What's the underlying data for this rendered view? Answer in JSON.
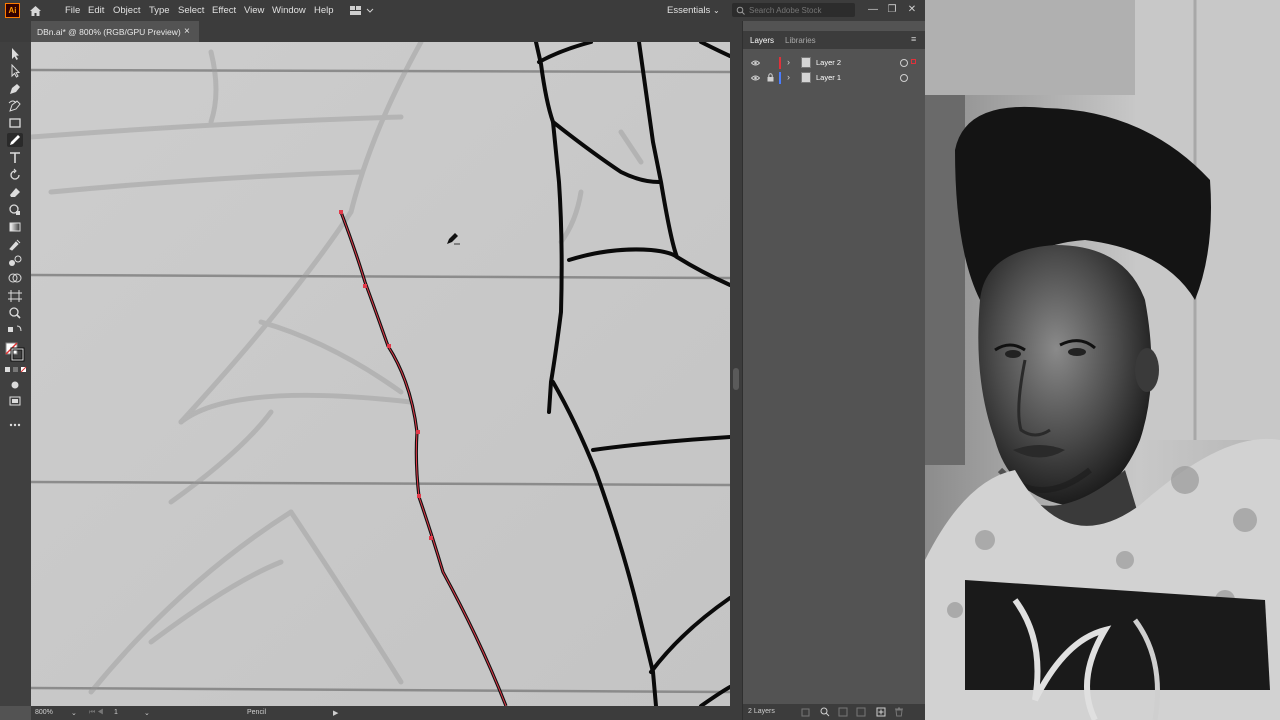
{
  "app": {
    "logo_text": "Ai"
  },
  "menu": [
    "File",
    "Edit",
    "Object",
    "Type",
    "Select",
    "Effect",
    "View",
    "Window",
    "Help"
  ],
  "workspace": {
    "label": "Essentials"
  },
  "search": {
    "placeholder": "Search Adobe Stock"
  },
  "document": {
    "tab_title": "DBn.ai* @ 800% (RGB/GPU Preview)",
    "close_glyph": "×"
  },
  "window_controls": {
    "minimize": "—",
    "restore": "❐",
    "close": "✕"
  },
  "status": {
    "zoom": "800%",
    "artboard": "1",
    "tool": "Pencil"
  },
  "layers_panel": {
    "tabs": [
      "Layers",
      "Libraries"
    ],
    "menu_glyph": "≡",
    "layers": [
      {
        "name": "Layer 2",
        "color": "#e0313a"
      },
      {
        "name": "Layer 1",
        "color": "#4a7dff"
      }
    ],
    "count": "2 Layers"
  },
  "accent_colors": {
    "selection_path": "#e23a4a",
    "app_logo": "#ff7c00"
  },
  "icons": {
    "tools": [
      "selection-tool",
      "direct-selection-tool",
      "pen-tool",
      "curvature-tool",
      "rectangle-tool",
      "pencil-tool",
      "type-tool",
      "rotate-tool",
      "eraser-tool",
      "scale-tool",
      "gradient-tool",
      "eyedropper-tool",
      "blend-tool",
      "shape-builder-tool",
      "artboard-tool",
      "zoom-tool"
    ]
  }
}
